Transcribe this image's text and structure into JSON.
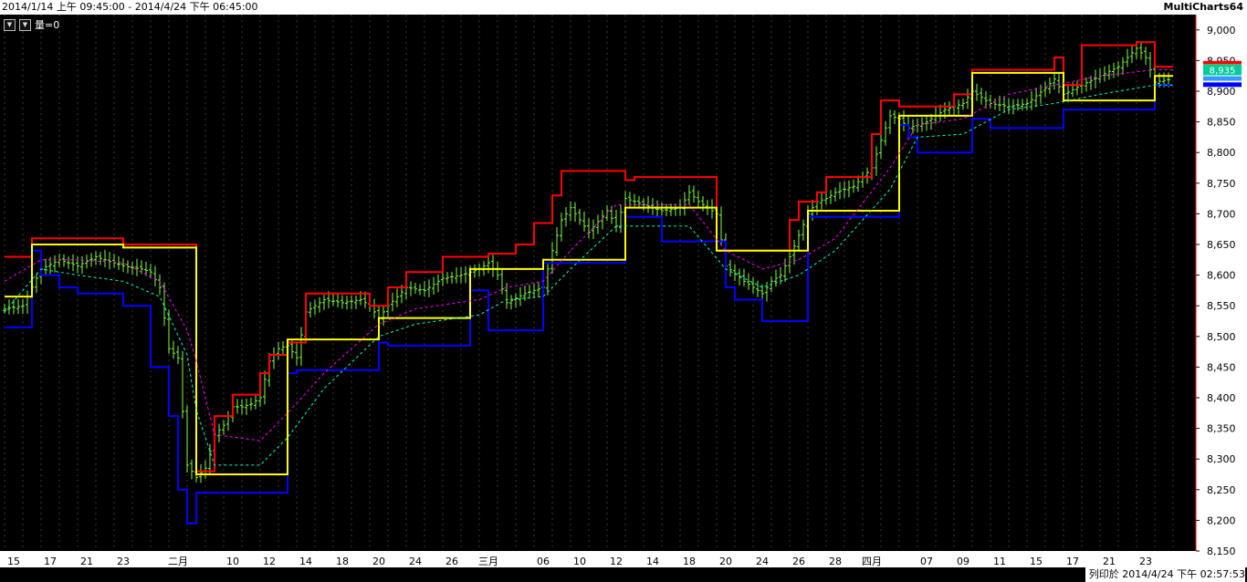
{
  "title_bar": {
    "range": "2014/1/14 上午 09:45:00 - 2014/4/24 下午 06:45:00",
    "app": "MultiCharts64"
  },
  "controls": {
    "volume_label": "量=0",
    "dropdown_icon": "chevron-down-icon"
  },
  "footer": {
    "print_text": "列印於 2014/4/24 下午 02:57:53"
  },
  "colors": {
    "background": "#000000",
    "upper_band": "#ff0000",
    "lower_band": "#0000ff",
    "mid_line": "#ffff00",
    "bars": "#7fff3f",
    "dash_upper": "#ff00ff",
    "dash_lower": "#00ffcc",
    "grid": "#3a3a3a"
  },
  "chart_data": {
    "type": "line",
    "title": "",
    "xlabel": "",
    "ylabel": "",
    "ylim": [
      8150,
      9025
    ],
    "grid": true,
    "y_ticks": [
      "9,000",
      "8,950",
      "8,900",
      "8,850",
      "8,800",
      "8,750",
      "8,700",
      "8,650",
      "8,600",
      "8,550",
      "8,500",
      "8,450",
      "8,400",
      "8,350",
      "8,300",
      "8,250",
      "8,200",
      "8,150"
    ],
    "x_tick_labels": [
      "15",
      "17",
      "21",
      "23",
      "二月",
      "10",
      "12",
      "14",
      "18",
      "20",
      "24",
      "26",
      "三月",
      "06",
      "10",
      "12",
      "14",
      "18",
      "20",
      "24",
      "26",
      "28",
      "四月",
      "07",
      "09",
      "11",
      "15",
      "17",
      "21",
      "23"
    ],
    "x_tick_positions": [
      2,
      10,
      18,
      26,
      38,
      50,
      58,
      66,
      74,
      82,
      90,
      98,
      106,
      118,
      126,
      134,
      142,
      150,
      158,
      166,
      174,
      182,
      190,
      202,
      210,
      218,
      226,
      234,
      242,
      250
    ],
    "x_count": 260,
    "last_value_label": "8,935",
    "series": [
      {
        "name": "",
        "role": "upper",
        "points": [
          [
            0,
            8630
          ],
          [
            6,
            8630
          ],
          [
            6,
            8660
          ],
          [
            26,
            8660
          ],
          [
            26,
            8650
          ],
          [
            42,
            8650
          ],
          [
            42,
            8280
          ],
          [
            46,
            8280
          ],
          [
            46,
            8370
          ],
          [
            50,
            8370
          ],
          [
            50,
            8405
          ],
          [
            56,
            8405
          ],
          [
            56,
            8440
          ],
          [
            58,
            8440
          ],
          [
            58,
            8470
          ],
          [
            62,
            8470
          ],
          [
            62,
            8490
          ],
          [
            66,
            8490
          ],
          [
            66,
            8570
          ],
          [
            80,
            8570
          ],
          [
            80,
            8550
          ],
          [
            84,
            8550
          ],
          [
            84,
            8580
          ],
          [
            88,
            8580
          ],
          [
            88,
            8605
          ],
          [
            96,
            8605
          ],
          [
            96,
            8630
          ],
          [
            106,
            8630
          ],
          [
            106,
            8635
          ],
          [
            112,
            8635
          ],
          [
            112,
            8650
          ],
          [
            116,
            8650
          ],
          [
            116,
            8685
          ],
          [
            120,
            8685
          ],
          [
            120,
            8730
          ],
          [
            122,
            8730
          ],
          [
            122,
            8770
          ],
          [
            136,
            8770
          ],
          [
            136,
            8755
          ],
          [
            138,
            8755
          ],
          [
            138,
            8760
          ],
          [
            156,
            8760
          ],
          [
            156,
            8640
          ],
          [
            172,
            8640
          ],
          [
            172,
            8690
          ],
          [
            174,
            8690
          ],
          [
            174,
            8720
          ],
          [
            178,
            8720
          ],
          [
            178,
            8735
          ],
          [
            180,
            8735
          ],
          [
            180,
            8760
          ],
          [
            190,
            8760
          ],
          [
            190,
            8830
          ],
          [
            192,
            8830
          ],
          [
            192,
            8885
          ],
          [
            196,
            8885
          ],
          [
            196,
            8875
          ],
          [
            208,
            8875
          ],
          [
            208,
            8895
          ],
          [
            212,
            8895
          ],
          [
            212,
            8935
          ],
          [
            230,
            8935
          ],
          [
            230,
            8955
          ],
          [
            232,
            8955
          ],
          [
            232,
            8910
          ],
          [
            236,
            8910
          ],
          [
            236,
            8975
          ],
          [
            248,
            8975
          ],
          [
            248,
            8980
          ],
          [
            252,
            8980
          ],
          [
            252,
            8940
          ],
          [
            256,
            8940
          ]
        ]
      },
      {
        "name": "",
        "role": "lower",
        "points": [
          [
            0,
            8515
          ],
          [
            6,
            8515
          ],
          [
            6,
            8640
          ],
          [
            8,
            8640
          ],
          [
            8,
            8600
          ],
          [
            12,
            8600
          ],
          [
            12,
            8580
          ],
          [
            16,
            8580
          ],
          [
            16,
            8570
          ],
          [
            26,
            8570
          ],
          [
            26,
            8550
          ],
          [
            32,
            8550
          ],
          [
            32,
            8450
          ],
          [
            36,
            8450
          ],
          [
            36,
            8370
          ],
          [
            38,
            8370
          ],
          [
            38,
            8250
          ],
          [
            40,
            8250
          ],
          [
            40,
            8195
          ],
          [
            42,
            8195
          ],
          [
            42,
            8245
          ],
          [
            62,
            8245
          ],
          [
            62,
            8440
          ],
          [
            64,
            8440
          ],
          [
            64,
            8445
          ],
          [
            82,
            8445
          ],
          [
            82,
            8490
          ],
          [
            84,
            8490
          ],
          [
            84,
            8485
          ],
          [
            102,
            8485
          ],
          [
            102,
            8575
          ],
          [
            106,
            8575
          ],
          [
            106,
            8510
          ],
          [
            118,
            8510
          ],
          [
            118,
            8620
          ],
          [
            136,
            8620
          ],
          [
            136,
            8695
          ],
          [
            144,
            8695
          ],
          [
            144,
            8655
          ],
          [
            158,
            8655
          ],
          [
            158,
            8580
          ],
          [
            160,
            8580
          ],
          [
            160,
            8560
          ],
          [
            166,
            8560
          ],
          [
            166,
            8525
          ],
          [
            176,
            8525
          ],
          [
            176,
            8695
          ],
          [
            196,
            8695
          ],
          [
            196,
            8845
          ],
          [
            198,
            8845
          ],
          [
            198,
            8825
          ],
          [
            200,
            8825
          ],
          [
            200,
            8800
          ],
          [
            212,
            8800
          ],
          [
            212,
            8855
          ],
          [
            216,
            8855
          ],
          [
            216,
            8840
          ],
          [
            232,
            8840
          ],
          [
            232,
            8870
          ],
          [
            252,
            8870
          ],
          [
            252,
            8910
          ],
          [
            256,
            8910
          ]
        ]
      },
      {
        "name": "",
        "role": "mid",
        "points": [
          [
            0,
            8565
          ],
          [
            6,
            8565
          ],
          [
            6,
            8650
          ],
          [
            26,
            8650
          ],
          [
            26,
            8645
          ],
          [
            42,
            8645
          ],
          [
            42,
            8275
          ],
          [
            62,
            8275
          ],
          [
            62,
            8495
          ],
          [
            82,
            8495
          ],
          [
            82,
            8530
          ],
          [
            102,
            8530
          ],
          [
            102,
            8610
          ],
          [
            118,
            8610
          ],
          [
            118,
            8625
          ],
          [
            136,
            8625
          ],
          [
            136,
            8710
          ],
          [
            156,
            8710
          ],
          [
            156,
            8640
          ],
          [
            176,
            8640
          ],
          [
            176,
            8705
          ],
          [
            196,
            8705
          ],
          [
            196,
            8860
          ],
          [
            212,
            8860
          ],
          [
            212,
            8930
          ],
          [
            232,
            8930
          ],
          [
            232,
            8885
          ],
          [
            252,
            8885
          ],
          [
            252,
            8925
          ],
          [
            256,
            8925
          ]
        ]
      },
      {
        "name": "",
        "role": "dash-upper",
        "points": [
          [
            0,
            8590
          ],
          [
            8,
            8625
          ],
          [
            16,
            8625
          ],
          [
            26,
            8620
          ],
          [
            34,
            8590
          ],
          [
            40,
            8510
          ],
          [
            42,
            8460
          ],
          [
            46,
            8340
          ],
          [
            56,
            8330
          ],
          [
            62,
            8375
          ],
          [
            70,
            8440
          ],
          [
            82,
            8520
          ],
          [
            90,
            8545
          ],
          [
            104,
            8560
          ],
          [
            110,
            8580
          ],
          [
            118,
            8590
          ],
          [
            124,
            8640
          ],
          [
            134,
            8715
          ],
          [
            150,
            8715
          ],
          [
            158,
            8640
          ],
          [
            166,
            8610
          ],
          [
            174,
            8625
          ],
          [
            182,
            8660
          ],
          [
            194,
            8775
          ],
          [
            200,
            8845
          ],
          [
            210,
            8855
          ],
          [
            220,
            8895
          ],
          [
            230,
            8910
          ],
          [
            240,
            8925
          ],
          [
            252,
            8935
          ],
          [
            256,
            8935
          ]
        ]
      },
      {
        "name": "",
        "role": "dash-lower",
        "points": [
          [
            0,
            8540
          ],
          [
            8,
            8610
          ],
          [
            16,
            8600
          ],
          [
            26,
            8590
          ],
          [
            34,
            8565
          ],
          [
            40,
            8470
          ],
          [
            42,
            8380
          ],
          [
            46,
            8290
          ],
          [
            56,
            8290
          ],
          [
            62,
            8335
          ],
          [
            70,
            8415
          ],
          [
            82,
            8500
          ],
          [
            90,
            8520
          ],
          [
            104,
            8535
          ],
          [
            110,
            8560
          ],
          [
            118,
            8565
          ],
          [
            124,
            8610
          ],
          [
            134,
            8680
          ],
          [
            150,
            8680
          ],
          [
            158,
            8610
          ],
          [
            166,
            8580
          ],
          [
            174,
            8600
          ],
          [
            182,
            8640
          ],
          [
            194,
            8740
          ],
          [
            200,
            8825
          ],
          [
            210,
            8830
          ],
          [
            220,
            8870
          ],
          [
            230,
            8880
          ],
          [
            240,
            8895
          ],
          [
            252,
            8910
          ],
          [
            256,
            8910
          ]
        ]
      }
    ],
    "close_path": [
      [
        0,
        8545
      ],
      [
        4,
        8550
      ],
      [
        8,
        8610
      ],
      [
        12,
        8625
      ],
      [
        16,
        8615
      ],
      [
        20,
        8630
      ],
      [
        24,
        8620
      ],
      [
        26,
        8615
      ],
      [
        30,
        8610
      ],
      [
        32,
        8605
      ],
      [
        34,
        8580
      ],
      [
        36,
        8480
      ],
      [
        38,
        8465
      ],
      [
        40,
        8290
      ],
      [
        42,
        8270
      ],
      [
        44,
        8285
      ],
      [
        46,
        8340
      ],
      [
        48,
        8355
      ],
      [
        50,
        8385
      ],
      [
        52,
        8385
      ],
      [
        54,
        8390
      ],
      [
        56,
        8400
      ],
      [
        58,
        8460
      ],
      [
        60,
        8480
      ],
      [
        62,
        8485
      ],
      [
        64,
        8465
      ],
      [
        66,
        8540
      ],
      [
        70,
        8560
      ],
      [
        74,
        8555
      ],
      [
        78,
        8560
      ],
      [
        80,
        8550
      ],
      [
        82,
        8530
      ],
      [
        84,
        8550
      ],
      [
        88,
        8580
      ],
      [
        92,
        8575
      ],
      [
        96,
        8595
      ],
      [
        100,
        8600
      ],
      [
        104,
        8610
      ],
      [
        106,
        8620
      ],
      [
        108,
        8600
      ],
      [
        110,
        8555
      ],
      [
        114,
        8570
      ],
      [
        118,
        8580
      ],
      [
        120,
        8640
      ],
      [
        122,
        8690
      ],
      [
        124,
        8710
      ],
      [
        126,
        8690
      ],
      [
        128,
        8670
      ],
      [
        132,
        8705
      ],
      [
        134,
        8680
      ],
      [
        136,
        8725
      ],
      [
        140,
        8715
      ],
      [
        144,
        8705
      ],
      [
        148,
        8710
      ],
      [
        150,
        8735
      ],
      [
        152,
        8720
      ],
      [
        156,
        8700
      ],
      [
        158,
        8615
      ],
      [
        162,
        8590
      ],
      [
        166,
        8570
      ],
      [
        168,
        8590
      ],
      [
        170,
        8600
      ],
      [
        172,
        8630
      ],
      [
        174,
        8665
      ],
      [
        176,
        8700
      ],
      [
        178,
        8720
      ],
      [
        180,
        8725
      ],
      [
        182,
        8735
      ],
      [
        186,
        8745
      ],
      [
        190,
        8775
      ],
      [
        192,
        8820
      ],
      [
        194,
        8860
      ],
      [
        196,
        8855
      ],
      [
        198,
        8840
      ],
      [
        202,
        8850
      ],
      [
        206,
        8870
      ],
      [
        210,
        8880
      ],
      [
        212,
        8900
      ],
      [
        216,
        8880
      ],
      [
        220,
        8875
      ],
      [
        224,
        8880
      ],
      [
        228,
        8905
      ],
      [
        230,
        8920
      ],
      [
        232,
        8895
      ],
      [
        236,
        8910
      ],
      [
        240,
        8925
      ],
      [
        244,
        8940
      ],
      [
        248,
        8970
      ],
      [
        250,
        8955
      ],
      [
        252,
        8915
      ],
      [
        256,
        8920
      ]
    ]
  }
}
